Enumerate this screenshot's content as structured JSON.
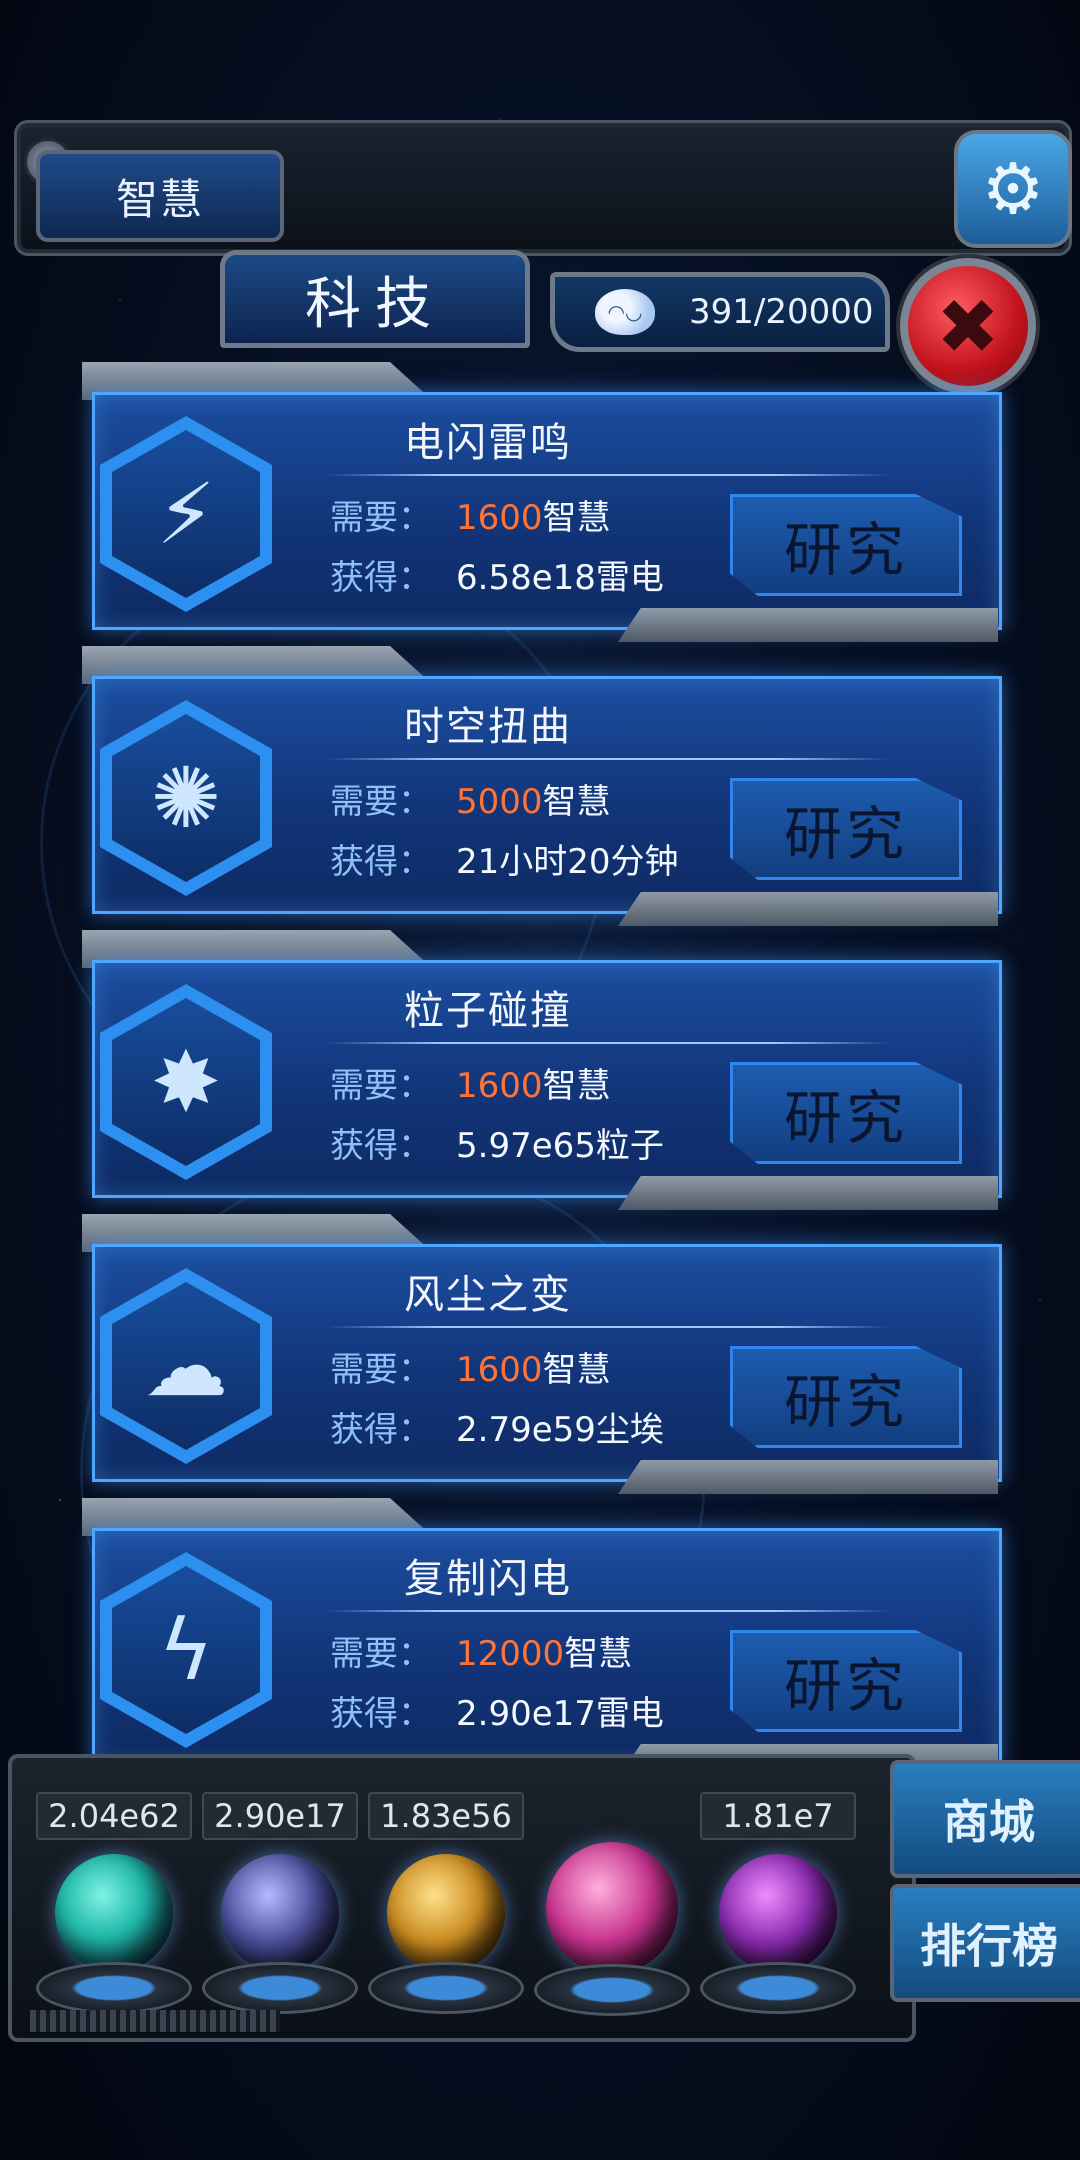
{
  "header": {
    "wisdom_tab_label": "智慧",
    "settings_icon": "gear-icon"
  },
  "panel": {
    "title": "科技",
    "resource_icon": "brain-icon",
    "resource_counter": "391/20000",
    "close_icon": "close-icon"
  },
  "techs": [
    {
      "icon": "lightning-strike-icon",
      "glyph": "⚡",
      "name": "电闪雷鸣",
      "need_label": "需要：",
      "cost": "1600",
      "cost_unit": "智慧",
      "gain_label": "获得：",
      "gain": "6.58e18雷电",
      "button": "研究"
    },
    {
      "icon": "spacetime-vortex-icon",
      "glyph": "✺",
      "name": "时空扭曲",
      "need_label": "需要：",
      "cost": "5000",
      "cost_unit": "智慧",
      "gain_label": "获得：",
      "gain": "21小时20分钟",
      "button": "研究"
    },
    {
      "icon": "particle-collision-icon",
      "glyph": "✸",
      "name": "粒子碰撞",
      "need_label": "需要：",
      "cost": "1600",
      "cost_unit": "智慧",
      "gain_label": "获得：",
      "gain": "5.97e65粒子",
      "button": "研究"
    },
    {
      "icon": "dust-cloud-icon",
      "glyph": "☁",
      "name": "风尘之变",
      "need_label": "需要：",
      "cost": "1600",
      "cost_unit": "智慧",
      "gain_label": "获得：",
      "gain": "2.79e59尘埃",
      "button": "研究"
    },
    {
      "icon": "copy-lightning-icon",
      "glyph": "ϟ",
      "name": "复制闪电",
      "need_label": "需要：",
      "cost": "12000",
      "cost_unit": "智慧",
      "gain_label": "获得：",
      "gain": "2.90e17雷电",
      "button": "研究"
    }
  ],
  "orbs": [
    {
      "value": "2.04e62",
      "icon": "particle-orb-icon",
      "color": "#1fb7a8"
    },
    {
      "value": "2.90e17",
      "icon": "lightning-orb-icon",
      "color": "#4b4f9a"
    },
    {
      "value": "1.83e56",
      "icon": "dust-orb-icon",
      "color": "#c98b20"
    },
    {
      "value": "",
      "icon": "brain-orb-icon",
      "color": "#c8348f"
    },
    {
      "value": "1.81e7",
      "icon": "vortex-orb-icon",
      "color": "#8a2bb0"
    }
  ],
  "side_buttons": {
    "mall": "商城",
    "ranking": "排行榜"
  }
}
